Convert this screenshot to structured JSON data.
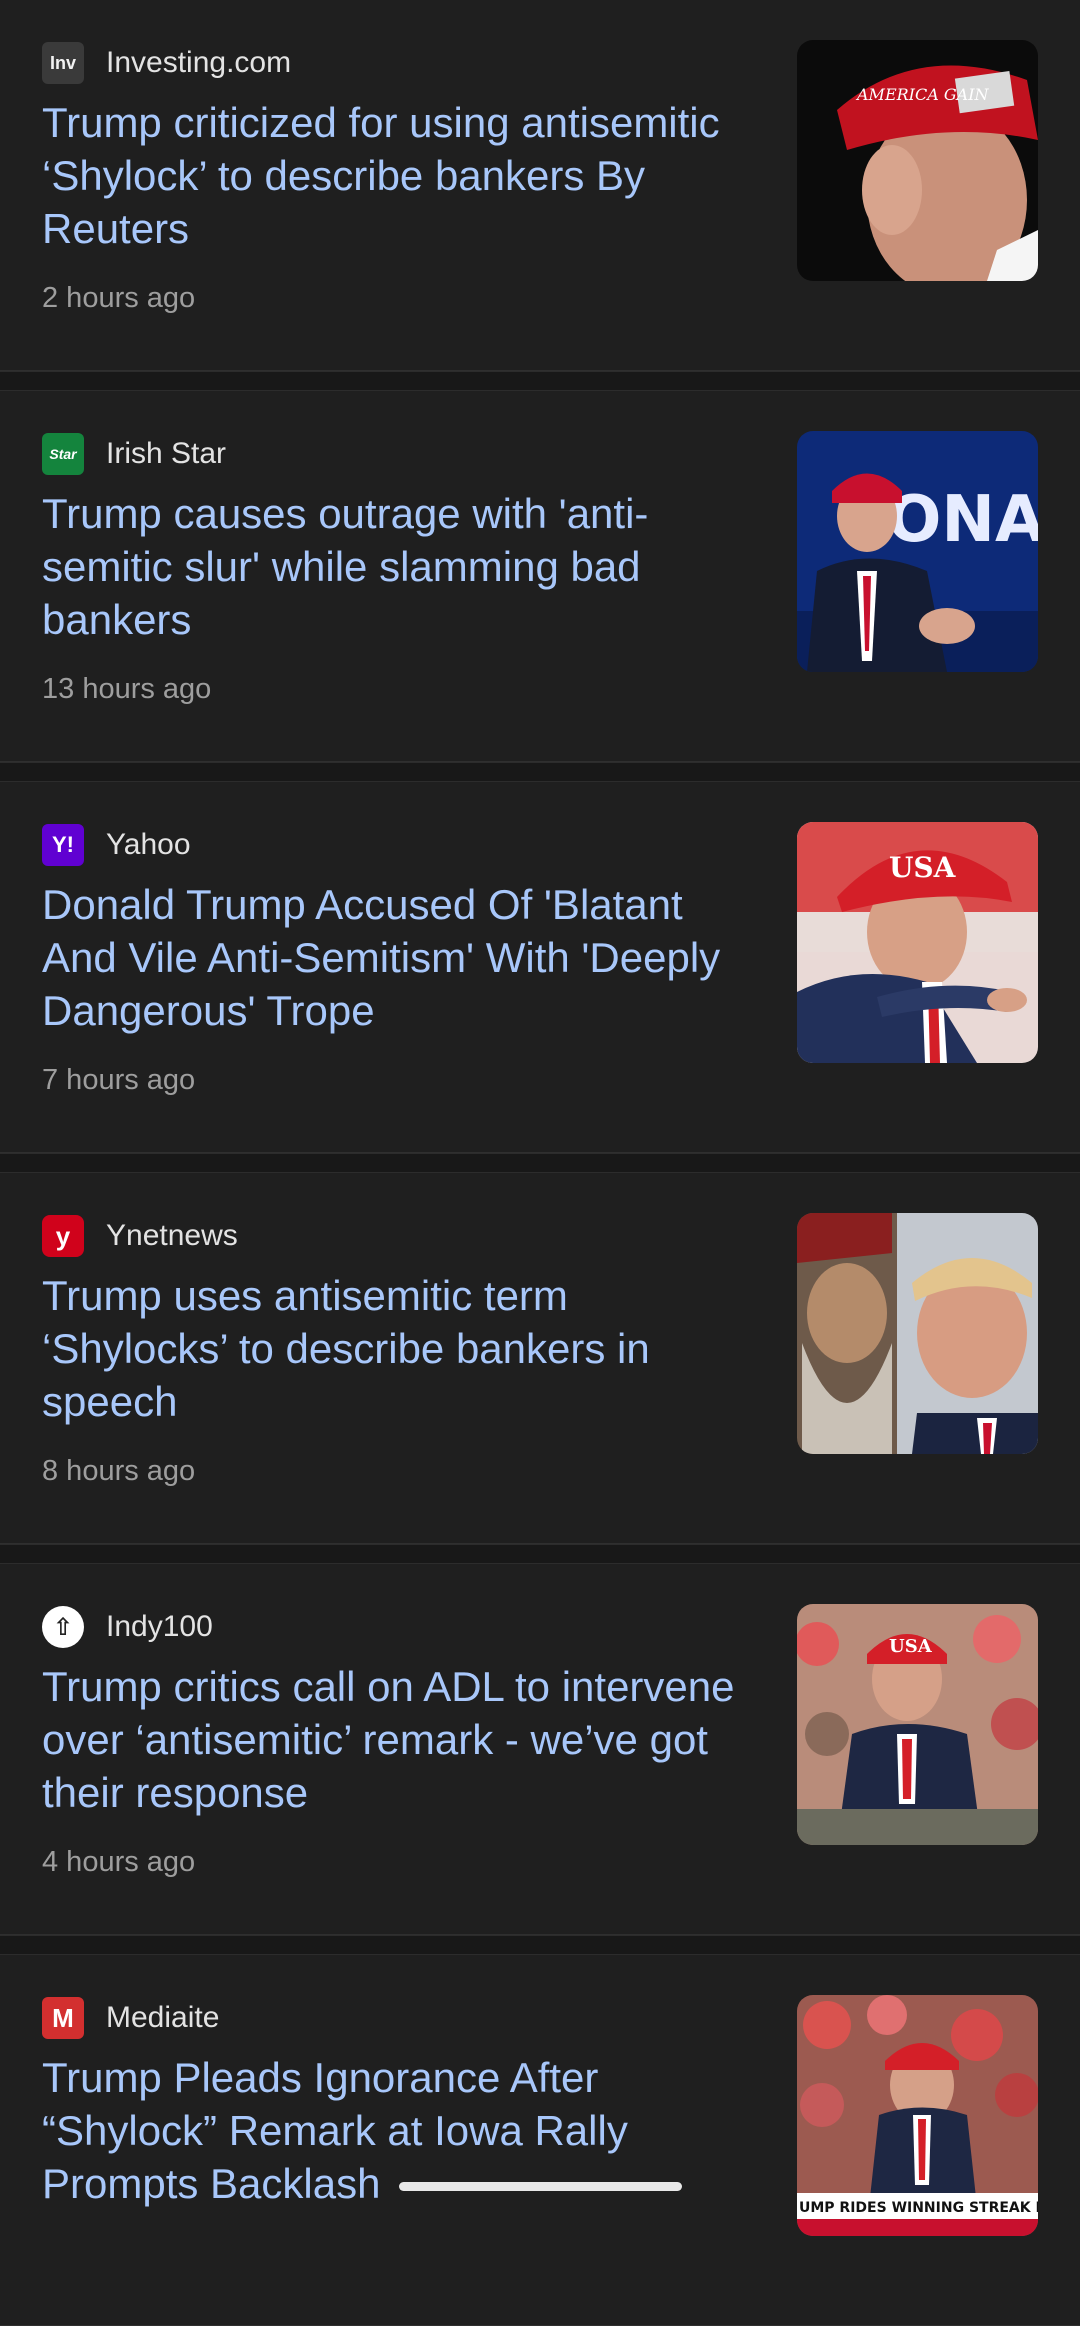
{
  "articles": [
    {
      "source": "Investing.com",
      "logo_text": "Inv",
      "logo_icon": "investing-logo-icon",
      "headline": "Trump criticized for using antisemitic ‘Shylock’ to describe bankers By Reuters",
      "time": "2 hours ago"
    },
    {
      "source": "Irish Star",
      "logo_text": "Star",
      "logo_icon": "irish-star-logo-icon",
      "headline": "Trump causes outrage with 'anti-semitic slur' while slamming bad bankers",
      "time": "13 hours ago"
    },
    {
      "source": "Yahoo",
      "logo_text": "Y!",
      "logo_icon": "yahoo-logo-icon",
      "headline": "Donald Trump Accused Of 'Blatant And Vile Anti-Semitism' With 'Deeply Dangerous' Trope",
      "time": "7 hours ago"
    },
    {
      "source": "Ynetnews",
      "logo_text": "y",
      "logo_icon": "ynetnews-logo-icon",
      "headline": "Trump uses antisemitic term ‘Shylocks’ to describe bankers in speech",
      "time": "8 hours ago"
    },
    {
      "source": "Indy100",
      "logo_text": "⇧",
      "logo_icon": "indy100-logo-icon",
      "headline": "Trump critics call on ADL to intervene over ‘antisemitic’ remark - we’ve got their response",
      "time": "4 hours ago"
    },
    {
      "source": "Mediaite",
      "logo_text": "M",
      "logo_icon": "mediaite-logo-icon",
      "headline": "Trump Pleads Ignorance After “Shylock” Remark at Iowa Rally Prompts Backlash",
      "time": ""
    }
  ],
  "thumbnails": {
    "t1_cap_text": "AMERICA GAIN",
    "t2_banner_text": "ONAL RUN",
    "t3_cap_text": "USA",
    "t5_cap_text": "USA",
    "t6_ticker_text": "UMP RIDES WINNING STREAK IN"
  },
  "colors": {
    "background": "#1f1f1f",
    "headline": "#a8c7fa",
    "source": "#e3e3e3",
    "time": "#9e9e9e"
  }
}
